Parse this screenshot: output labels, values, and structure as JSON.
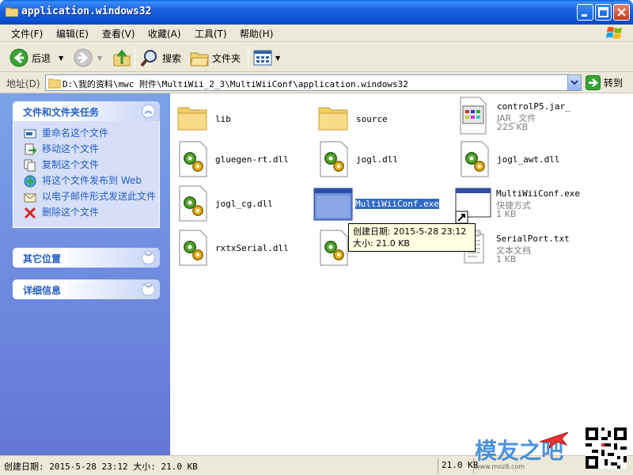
{
  "window": {
    "title": "application.windows32"
  },
  "menu": {
    "items": [
      "文件(F)",
      "编辑(E)",
      "查看(V)",
      "收藏(A)",
      "工具(T)",
      "帮助(H)"
    ]
  },
  "toolbar": {
    "back_label": "后退",
    "search_label": "搜索",
    "folders_label": "文件夹"
  },
  "address": {
    "label": "地址(D)",
    "path": "D:\\我的资料\\mwc 附件\\MultiWii_2_3\\MultiWiiConf\\application.windows32",
    "go_label": "转到"
  },
  "left_panel": {
    "file_tasks": {
      "title": "文件和文件夹任务",
      "items": [
        {
          "label": "重命名这个文件",
          "icon": "rename-icon"
        },
        {
          "label": "移动这个文件",
          "icon": "move-icon"
        },
        {
          "label": "复制这个文件",
          "icon": "copy-icon"
        },
        {
          "label": "将这个文件发布到 Web",
          "icon": "publish-web-icon"
        },
        {
          "label": "以电子邮件形式发送此文件",
          "icon": "email-icon"
        },
        {
          "label": "删除这个文件",
          "icon": "delete-icon"
        }
      ]
    },
    "other_places": {
      "title": "其它位置"
    },
    "details": {
      "title": "详细信息"
    }
  },
  "files": [
    {
      "name": "lib",
      "icon": "folder-icon"
    },
    {
      "name": "source",
      "icon": "folder-icon"
    },
    {
      "name": "controlP5.jar_",
      "type": "JAR_ 文件",
      "size": "225 KB",
      "icon": "jar-file-icon"
    },
    {
      "name": "gluegen-rt.dll",
      "icon": "dll-icon"
    },
    {
      "name": "jogl.dll",
      "icon": "dll-icon"
    },
    {
      "name": "jogl_awt.dll",
      "icon": "dll-icon"
    },
    {
      "name": "jogl_cg.dll",
      "icon": "dll-icon"
    },
    {
      "name": "MultiWiiConf.exe",
      "icon": "exe-icon",
      "selected": true
    },
    {
      "name": "MultiWiiConf.exe",
      "type": "快捷方式",
      "size": "1 KB",
      "icon": "shortcut-icon"
    },
    {
      "name": "rxtxSerial.dll",
      "icon": "dll-icon"
    },
    {
      "name": "",
      "icon": "dll-icon"
    },
    {
      "name": "SerialPort.txt",
      "type": "文本文档",
      "size": "1 KB",
      "icon": "text-file-icon"
    }
  ],
  "tooltip": {
    "line1": "创建日期: 2015-5-28 23:12",
    "line2": "大小: 21.0 KB"
  },
  "statusbar": {
    "info": "创建日期: 2015-5-28 23:12 大小: 21.0 KB",
    "size": "21.0 KB"
  },
  "watermark": {
    "text": "模友之吧",
    "url": "www.moz8.com"
  }
}
